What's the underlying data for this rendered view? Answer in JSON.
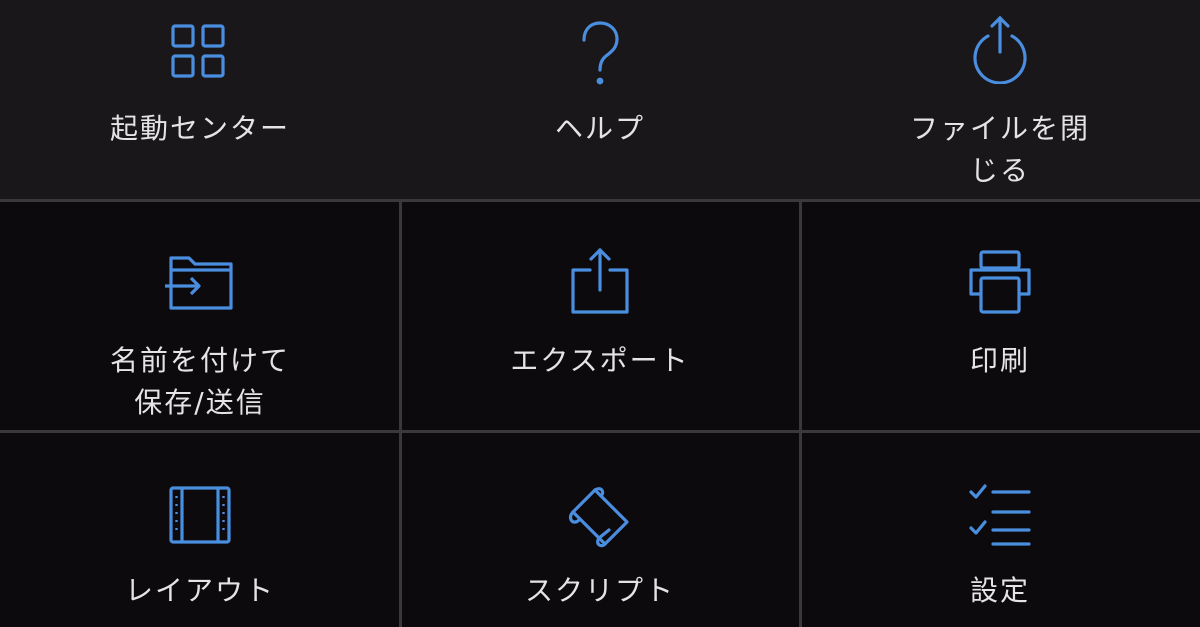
{
  "colors": {
    "background": "#0c0a0d",
    "top_row_background": "#1a171b",
    "icon_accent": "#4a8ee0",
    "label_text": "#e6e3e7",
    "divider": "#3b383c"
  },
  "menu": {
    "items": [
      {
        "label": "起動センター",
        "icon": "grid-icon"
      },
      {
        "label": "ヘルプ",
        "icon": "question-mark-icon"
      },
      {
        "label": "ファイルを閉\nじる",
        "icon": "power-icon"
      },
      {
        "label": "名前を付けて\n保存/送信",
        "icon": "folder-arrow-icon"
      },
      {
        "label": "エクスポート",
        "icon": "share-icon"
      },
      {
        "label": "印刷",
        "icon": "printer-icon"
      },
      {
        "label": "レイアウト",
        "icon": "film-layout-icon"
      },
      {
        "label": "スクリプト",
        "icon": "script-scroll-icon"
      },
      {
        "label": "設定",
        "icon": "checklist-icon"
      }
    ]
  }
}
